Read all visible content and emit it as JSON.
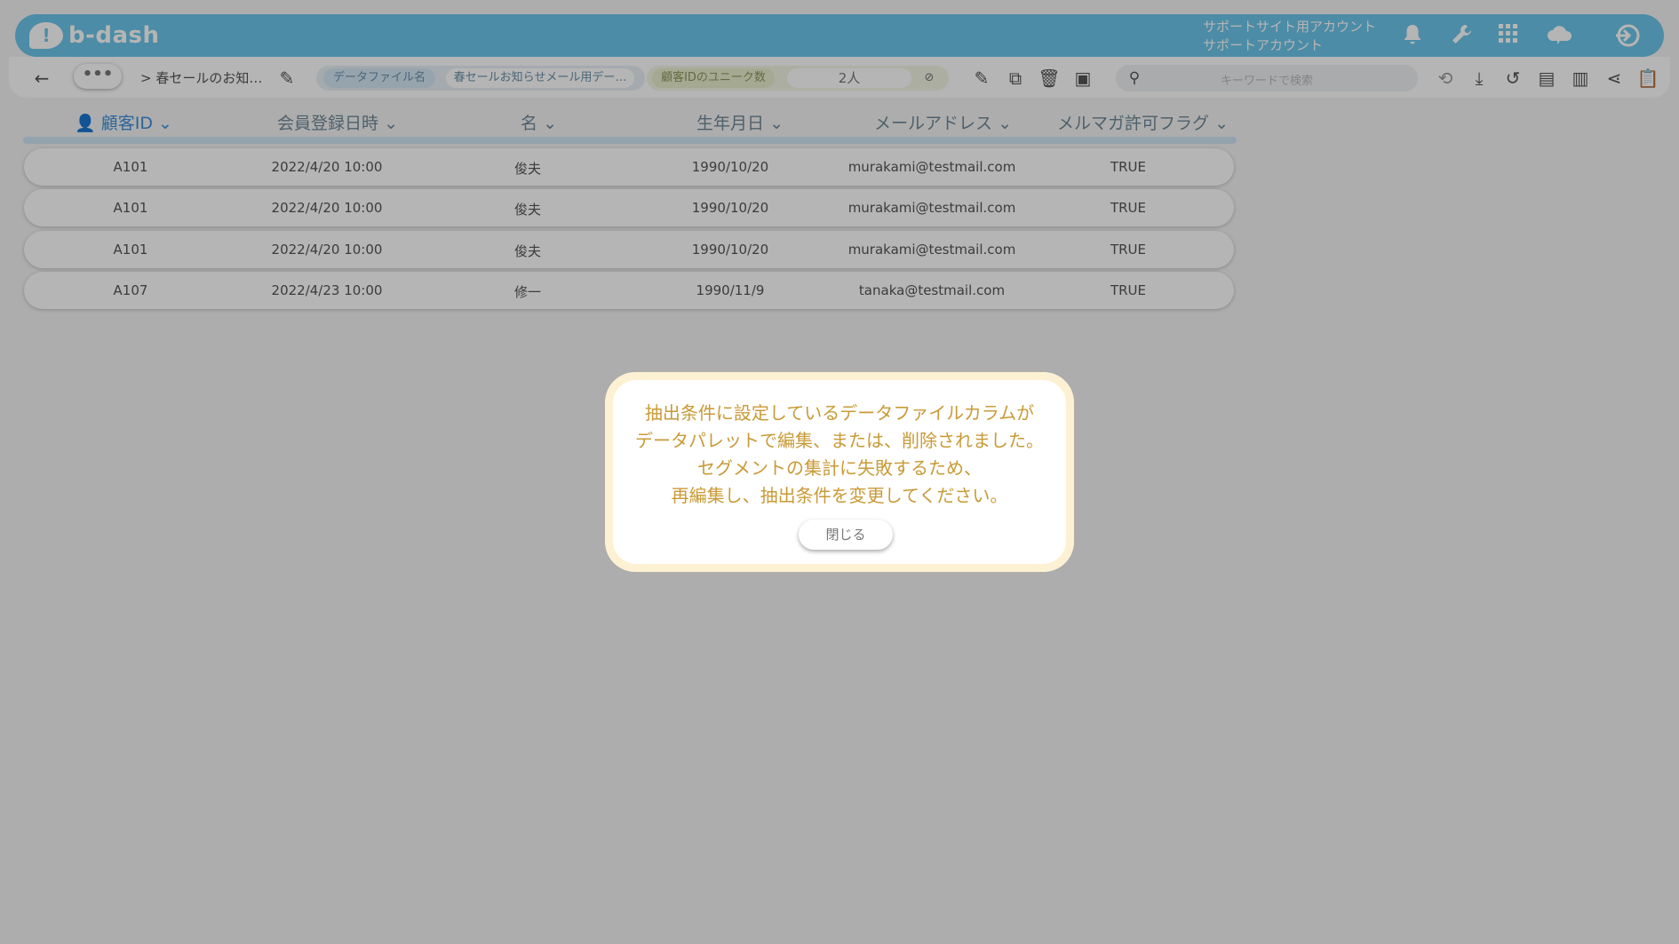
{
  "header": {
    "logo_text": "b-dash",
    "account_line1": "サポートサイト用アカウント",
    "account_line2": "サポートアカウント",
    "icons": [
      "bell-icon",
      "wrench-icon",
      "apps-grid-icon",
      "cloud-icon",
      "logout-icon"
    ]
  },
  "toolbar": {
    "ellipsis": "•••",
    "breadcrumb": "> 春セールのお知…",
    "datafile_label": "データファイル名",
    "datafile_value": "春セールお知らせメール用デー…",
    "unique_label": "顧客IDのユニーク数",
    "unique_value": "2人",
    "search_placeholder": "キーワードで検索"
  },
  "table": {
    "columns": [
      "顧客ID",
      "会員登録日時",
      "名",
      "生年月日",
      "メールアドレス",
      "メルマガ許可フラグ"
    ],
    "rows": [
      [
        "A101",
        "2022/4/20 10:00",
        "俊夫",
        "1990/10/20",
        "murakami@testmail.com",
        "TRUE"
      ],
      [
        "A101",
        "2022/4/20 10:00",
        "俊夫",
        "1990/10/20",
        "murakami@testmail.com",
        "TRUE"
      ],
      [
        "A101",
        "2022/4/20 10:00",
        "俊夫",
        "1990/10/20",
        "murakami@testmail.com",
        "TRUE"
      ],
      [
        "A107",
        "2022/4/23 10:00",
        "修一",
        "1990/11/9",
        "tanaka@testmail.com",
        "TRUE"
      ]
    ]
  },
  "dialog": {
    "lines": [
      "抽出条件に設定しているデータファイルカラムが",
      "データパレットで編集、または、削除されました。",
      "セグメントの集計に失敗するため、",
      "再編集し、抽出条件を変更してください。"
    ],
    "close_label": "閉じる"
  }
}
